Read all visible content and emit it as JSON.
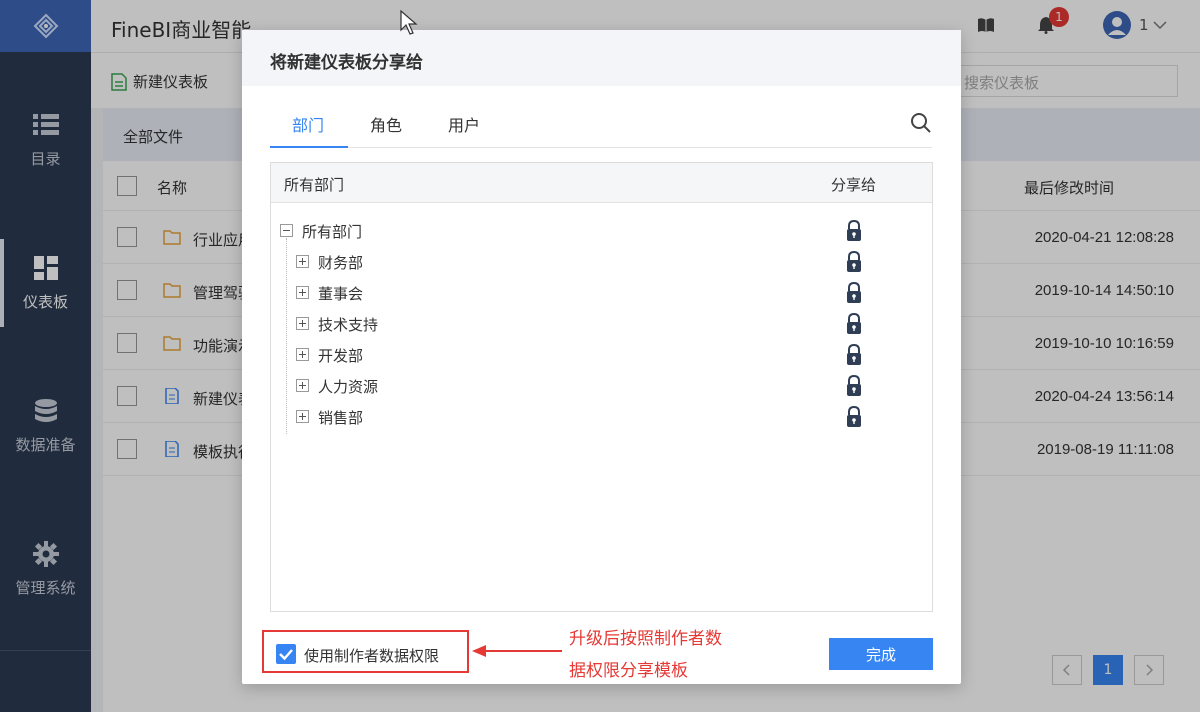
{
  "app": {
    "title": "FineBI商业智能",
    "notification_count": "1",
    "user_name": "1"
  },
  "sidebar": {
    "items": [
      {
        "label": "目录"
      },
      {
        "label": "仪表板"
      },
      {
        "label": "数据准备"
      },
      {
        "label": "管理系统"
      }
    ]
  },
  "toolbar": {
    "new_dashboard": "新建仪表板",
    "search_placeholder": "搜索仪表板"
  },
  "list": {
    "breadcrumb": "全部文件",
    "columns": {
      "name": "名称",
      "modified": "最后修改时间"
    },
    "rows": [
      {
        "name": "行业应用",
        "date": "2020-04-21 12:08:28"
      },
      {
        "name": "管理驾驶舱",
        "date": "2019-10-14 14:50:10"
      },
      {
        "name": "功能演示",
        "date": "2019-10-10 10:16:59"
      },
      {
        "name": "新建仪表板",
        "date": "2020-04-24 13:56:14"
      },
      {
        "name": "模板执行",
        "date": "2019-08-19 11:11:08"
      }
    ],
    "current_page": "1"
  },
  "dialog": {
    "title": "将新建仪表板分享给",
    "tabs": [
      {
        "label": "部门"
      },
      {
        "label": "角色"
      },
      {
        "label": "用户"
      }
    ],
    "tree_header": {
      "name": "所有部门",
      "share": "分享给"
    },
    "root": "所有部门",
    "departments": [
      "财务部",
      "董事会",
      "技术支持",
      "开发部",
      "人力资源",
      "销售部"
    ],
    "use_creator_permission": "使用制作者数据权限",
    "done": "完成"
  },
  "annotation": {
    "line1": "升级后按照制作者数",
    "line2": "据权限分享模板"
  },
  "colors": {
    "accent": "#3685f2",
    "sidebar": "#2b3a52",
    "annotation": "#e53935"
  }
}
